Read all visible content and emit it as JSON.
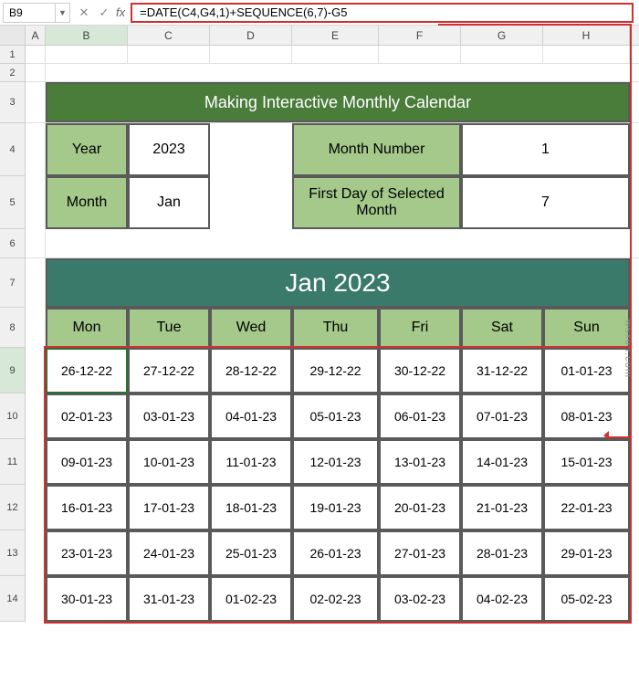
{
  "namebox": "B9",
  "formula": "=DATE(C4,G4,1)+SEQUENCE(6,7)-G5",
  "cols": [
    "A",
    "B",
    "C",
    "D",
    "E",
    "F",
    "G",
    "H"
  ],
  "rows": [
    "1",
    "2",
    "3",
    "4",
    "5",
    "6",
    "7",
    "8",
    "9",
    "10",
    "11",
    "12",
    "13",
    "14"
  ],
  "title": "Making Interactive Monthly Calendar",
  "info": {
    "year_label": "Year",
    "year_value": "2023",
    "month_label": "Month",
    "month_value": "Jan",
    "monthnum_label": "Month Number",
    "monthnum_value": "1",
    "firstday_label": "First Day of Selected Month",
    "firstday_value": "7"
  },
  "month_title": "Jan 2023",
  "days": [
    "Mon",
    "Tue",
    "Wed",
    "Thu",
    "Fri",
    "Sat",
    "Sun"
  ],
  "calendar": [
    [
      "26-12-22",
      "27-12-22",
      "28-12-22",
      "29-12-22",
      "30-12-22",
      "31-12-22",
      "01-01-23"
    ],
    [
      "02-01-23",
      "03-01-23",
      "04-01-23",
      "05-01-23",
      "06-01-23",
      "07-01-23",
      "08-01-23"
    ],
    [
      "09-01-23",
      "10-01-23",
      "11-01-23",
      "12-01-23",
      "13-01-23",
      "14-01-23",
      "15-01-23"
    ],
    [
      "16-01-23",
      "17-01-23",
      "18-01-23",
      "19-01-23",
      "20-01-23",
      "21-01-23",
      "22-01-23"
    ],
    [
      "23-01-23",
      "24-01-23",
      "25-01-23",
      "26-01-23",
      "27-01-23",
      "28-01-23",
      "29-01-23"
    ],
    [
      "30-01-23",
      "31-01-23",
      "01-02-23",
      "02-02-23",
      "03-02-23",
      "04-02-23",
      "05-02-23"
    ]
  ],
  "watermark": "wsxdn.com"
}
